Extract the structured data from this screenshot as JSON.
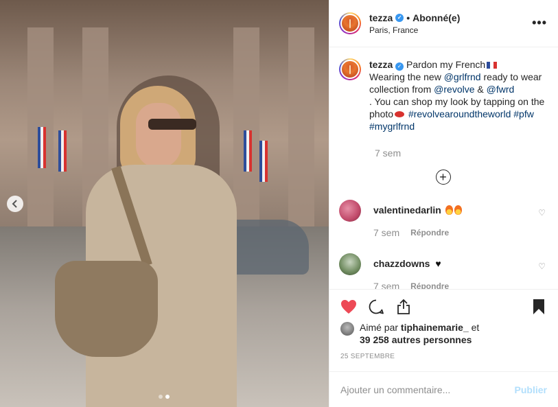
{
  "header": {
    "username": "tezza",
    "follow_status": "Abonné(e)",
    "separator": "•",
    "location": "Paris, France",
    "more": "•••"
  },
  "caption": {
    "username": "tezza",
    "text_1": "Pardon my French",
    "text_2": "Wearing the new",
    "mention_1": "@grlfrnd",
    "text_3": "ready to wear collection from",
    "mention_2": "@revolve",
    "text_4": "&",
    "mention_3": "@fwrd",
    "text_5": ". You can shop my look by tapping on the photo",
    "hashtag_1": "#revolvearoundtheworld",
    "hashtag_2": "#pfw",
    "hashtag_3": "#mygrlfrnd",
    "time": "7 sem"
  },
  "comments": [
    {
      "username": "valentinedarlin",
      "time": "7 sem",
      "reply": "Répondre"
    },
    {
      "username": "chazzdowns",
      "time": "7 sem",
      "reply": "Répondre"
    }
  ],
  "likes": {
    "prefix": "Aimé par",
    "username": "tiphainemarie_",
    "conj": "et",
    "others": "39 258 autres personnes"
  },
  "date": "25 septembre",
  "add_comment": {
    "placeholder": "Ajouter un commentaire...",
    "publish": "Publier"
  },
  "icons": {
    "like": "heart-filled-icon",
    "comment": "comment-bubble-icon",
    "share": "share-icon",
    "save": "bookmark-icon"
  },
  "carousel": {
    "slides": 2,
    "current": 2
  },
  "colors": {
    "like_red": "#ed4956",
    "link": "#003569",
    "verified": "#3897f0",
    "publish": "#b2dffc"
  }
}
